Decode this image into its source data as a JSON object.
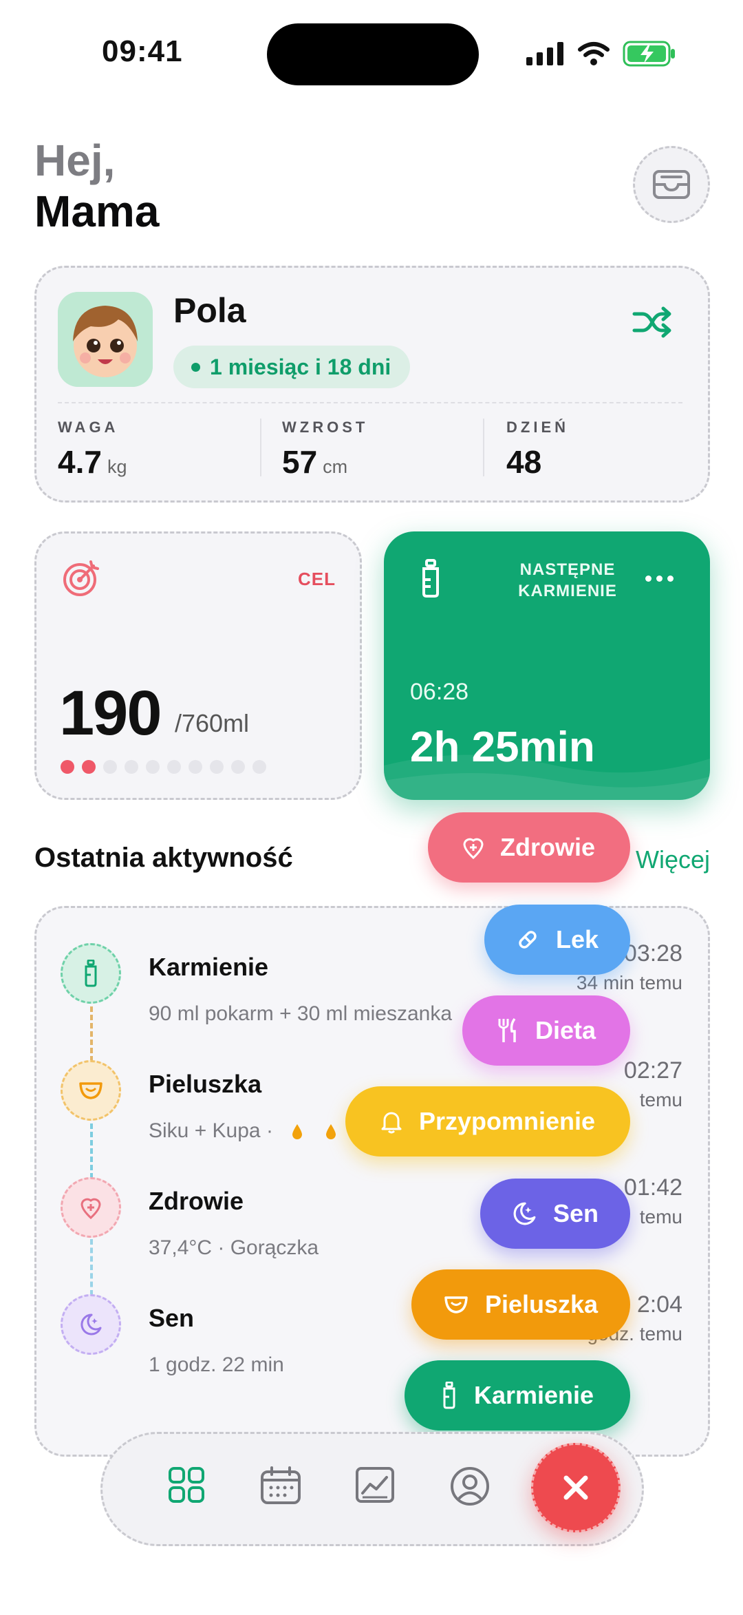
{
  "status_bar": {
    "time": "09:41"
  },
  "greeting": {
    "hello": "Hej,",
    "name": "Mama"
  },
  "baby": {
    "name": "Pola",
    "age": "1 miesiąc i 18 dni",
    "stats": [
      {
        "label": "WAGA",
        "value": "4.7",
        "unit": "kg"
      },
      {
        "label": "WZROST",
        "value": "57",
        "unit": "cm"
      },
      {
        "label": "DZIEŃ",
        "value": "48",
        "unit": ""
      }
    ]
  },
  "goal": {
    "label": "CEL",
    "value": "190",
    "target": "/760ml",
    "progress_dots_filled": 2,
    "progress_dots_total": 10
  },
  "feeding": {
    "title": "NASTĘPNE KARMIENIE",
    "time": "06:28",
    "remaining": "2h 25min"
  },
  "activity": {
    "title": "Ostatnia aktywność",
    "more": "Więcej",
    "items": [
      {
        "title": "Karmienie",
        "subtitle": "90 ml pokarm + 30 ml mieszanka",
        "time": "03:28",
        "ago": "34 min temu",
        "color": "#10a772"
      },
      {
        "title": "Pieluszka",
        "subtitle": "Siku + Kupa ·",
        "time": "02:27",
        "ago": "temu",
        "color": "#f2a20c"
      },
      {
        "title": "Zdrowie",
        "subtitle": "37,4°C · Gorączka",
        "time": "01:42",
        "ago": "temu",
        "color": "#f0707f"
      },
      {
        "title": "Sen",
        "subtitle": "1 godz. 22 min",
        "time": "2:04",
        "ago": "godz. temu",
        "color": "#9a79e8"
      }
    ]
  },
  "fab_menu": [
    {
      "label": "Zdrowie",
      "color": "#f26e80",
      "icon": "health-icon"
    },
    {
      "label": "Lek",
      "color": "#5aa6f3",
      "icon": "pill-icon"
    },
    {
      "label": "Dieta",
      "color": "#e274e6",
      "icon": "fork-knife-icon"
    },
    {
      "label": "Przypomnienie",
      "color": "#f8c321",
      "icon": "bell-icon"
    },
    {
      "label": "Sen",
      "color": "#6c63e6",
      "icon": "moon-icon"
    },
    {
      "label": "Pieluszka",
      "color": "#f29a0c",
      "icon": "diaper-icon"
    },
    {
      "label": "Karmienie",
      "color": "#10a772",
      "icon": "bottle-icon"
    }
  ],
  "nav": {
    "items": [
      "grid-icon",
      "calendar-icon",
      "chart-icon",
      "profile-icon"
    ],
    "close": "close-icon"
  }
}
